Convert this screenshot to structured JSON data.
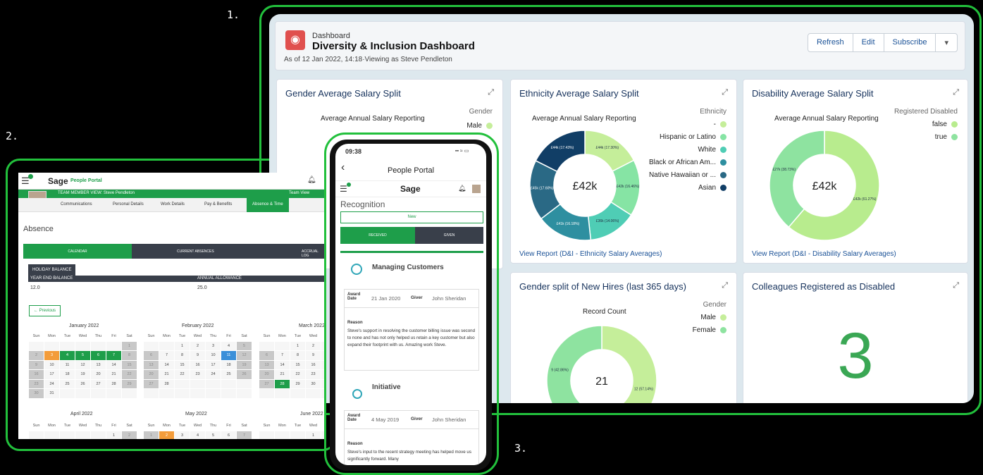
{
  "labels": {
    "one": "1.",
    "two": "2.",
    "three": "3."
  },
  "dashboard": {
    "breadcrumb": "Dashboard",
    "title": "Diversity & Inclusion Dashboard",
    "as_of": "As of 12 Jan 2022, 14:18·Viewing as Steve Pendleton",
    "buttons": {
      "refresh": "Refresh",
      "edit": "Edit",
      "subscribe": "Subscribe",
      "menu": "▾"
    },
    "cards": {
      "gender": {
        "title": "Gender Average Salary Split",
        "chart_title": "Average Annual Salary Reporting",
        "legend_title": "Gender",
        "legend": [
          "Male"
        ]
      },
      "ethnicity": {
        "title": "Ethnicity Average Salary Split",
        "chart_title": "Average Annual Salary Reporting",
        "legend_title": "Ethnicity",
        "legend": [
          "-",
          "Hispanic or Latino",
          "White",
          "Black or African Am...",
          "Native Hawaiian or ...",
          "Asian"
        ],
        "center": "£42k",
        "link": "View Report (D&I - Ethnicity Salary Averages)"
      },
      "disability": {
        "title": "Disability Average Salary Split",
        "chart_title": "Average Annual Salary Reporting",
        "legend_title": "Registered Disabled",
        "legend": [
          "false",
          "true"
        ],
        "center": "£42k",
        "link": "View Report (D&I - Disability Salary Averages)"
      },
      "hires": {
        "title": "Gender split of New Hires (last 365 days)",
        "chart_title": "Record Count",
        "legend_title": "Gender",
        "legend": [
          "Male",
          "Female"
        ],
        "center": "21"
      },
      "disabled": {
        "title": "Colleagues Registered as Disabled",
        "value": "3"
      }
    }
  },
  "chart_data": [
    {
      "type": "pie",
      "title": "Average Annual Salary Reporting",
      "legend_title": "Ethnicity",
      "categories": [
        "-",
        "Hispanic or Latino",
        "White",
        "Black or African Am...",
        "Native Hawaiian or ...",
        "Asian"
      ],
      "values": [
        17.3,
        16.46,
        14.06,
        16.18,
        17.6,
        17.43
      ],
      "labels": [
        "£44k (17.30%)",
        "£42k (16.46%)",
        "£36k (14.06%)",
        "£41k (16.18%)",
        "£45k (17.60%)",
        "£44k (17.43%)"
      ],
      "colors": [
        "#c5ee9a",
        "#86e4a4",
        "#4fcdb5",
        "#2e8fa0",
        "#2a6985",
        "#113e66"
      ],
      "center": "£42k"
    },
    {
      "type": "pie",
      "title": "Average Annual Salary Reporting",
      "legend_title": "Registered Disabled",
      "categories": [
        "false",
        "true"
      ],
      "values": [
        61.27,
        38.73
      ],
      "labels": [
        "£42k (61.27%)",
        "£27k (38.73%)"
      ],
      "colors": [
        "#b8ec8e",
        "#8ee3a0"
      ],
      "center": "£42k"
    },
    {
      "type": "pie",
      "title": "Record Count",
      "legend_title": "Gender",
      "categories": [
        "Male",
        "Female"
      ],
      "values": [
        12,
        9
      ],
      "labels": [
        "12 (57.14%)",
        "9 (42.86%)"
      ],
      "colors": [
        "#c5ee9a",
        "#8ee3a0"
      ],
      "center": "21"
    }
  ],
  "tablet": {
    "brand": "Sage",
    "portal": "People Portal",
    "member_view": "TEAM MEMBER VIEW: Steve Pendleton",
    "team_view": "Team View",
    "nav": [
      "Communications",
      "Personal Details",
      "Work Details",
      "Pay & Benefits",
      "Absence & Time"
    ],
    "section": "Absence",
    "tabs": [
      "CALENDAR",
      "CURRENT ABSENCES",
      "ACCRUAL LOG"
    ],
    "holiday_balance": "HOLIDAY BALANCE",
    "year_end_label": "YEAR END BALANCE",
    "allowance_label": "ANNUAL ALLOWANCE",
    "year_end": "12.0",
    "allowance": "25.0",
    "previous": "← Previous",
    "days": [
      "Sun",
      "Mon",
      "Tue",
      "Wed",
      "Thu",
      "Fri",
      "Sat"
    ],
    "months": [
      "January 2022",
      "February 2022",
      "March 2022",
      "April 2022",
      "May 2022",
      "June 2022"
    ]
  },
  "phone": {
    "time": "09:38",
    "status": "▪▪ ≈ ▭",
    "back": "‹",
    "title": "People Portal",
    "brand": "Sage",
    "section": "Recognition",
    "new": "New",
    "received": "RECEIVED",
    "given": "GIVEN",
    "awards": [
      {
        "name": "Managing Customers",
        "award_date_label": "Award Date",
        "date": "21 Jan 2020",
        "giver_label": "Giver",
        "giver": "John Sheridan",
        "reason_label": "Reason",
        "reason": "Steve's support in resolving the customer billing issue was second to none and has not only helped us retain a key customer but also expand their footprint with us. Amazing work Steve."
      },
      {
        "name": "Initiative",
        "award_date_label": "Award Date",
        "date": "4 May 2019",
        "giver_label": "Giver",
        "giver": "John Sheridan",
        "reason_label": "Reason",
        "reason": "Steve's input to the recent strategy meeting has helped move us significantly forward. Many"
      }
    ]
  }
}
